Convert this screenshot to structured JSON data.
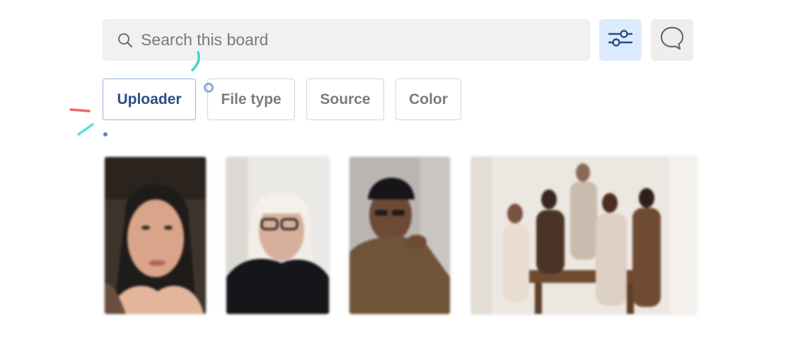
{
  "search": {
    "placeholder": "Search this board",
    "icon": "search-icon"
  },
  "toolbar": {
    "filter_icon": "sliders-icon",
    "comment_icon": "speech-bubble-icon",
    "accent_color": "#2a4c8c",
    "filter_bg": "#dcebfb"
  },
  "filters": [
    {
      "label": "Uploader",
      "active": true
    },
    {
      "label": "File type",
      "active": false
    },
    {
      "label": "Source",
      "active": false
    },
    {
      "label": "Color",
      "active": false
    }
  ],
  "gallery": {
    "images": [
      {
        "description": "portrait-woman-dark-hair"
      },
      {
        "description": "portrait-woman-blonde-glasses"
      },
      {
        "description": "portrait-man-beanie"
      },
      {
        "description": "group-photo-five-people"
      }
    ]
  }
}
